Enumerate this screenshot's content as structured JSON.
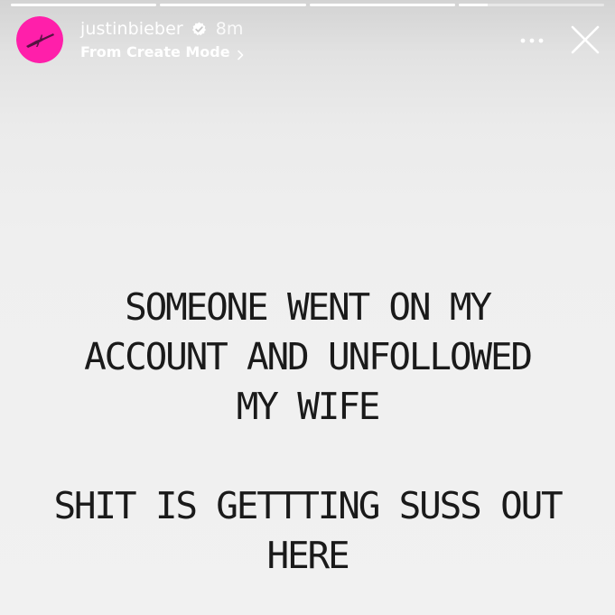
{
  "story": {
    "progress": [
      1.0,
      1.0,
      1.0,
      0.2
    ],
    "background": "#f0f0f0"
  },
  "header": {
    "username": "justinbieber",
    "time": "8m",
    "source": "From Create Mode",
    "avatar_color": "#ff1faa",
    "verified": true,
    "icons": [
      "verified-badge-icon",
      "chevron-right-icon",
      "more-icon",
      "close-icon"
    ]
  },
  "caption": {
    "lines": [
      "SOMEONE WENT ON MY",
      "ACCOUNT AND UNFOLLOWED",
      "MY WIFE",
      "",
      "SHIT IS GETTTING SUSS OUT",
      "HERE"
    ]
  }
}
